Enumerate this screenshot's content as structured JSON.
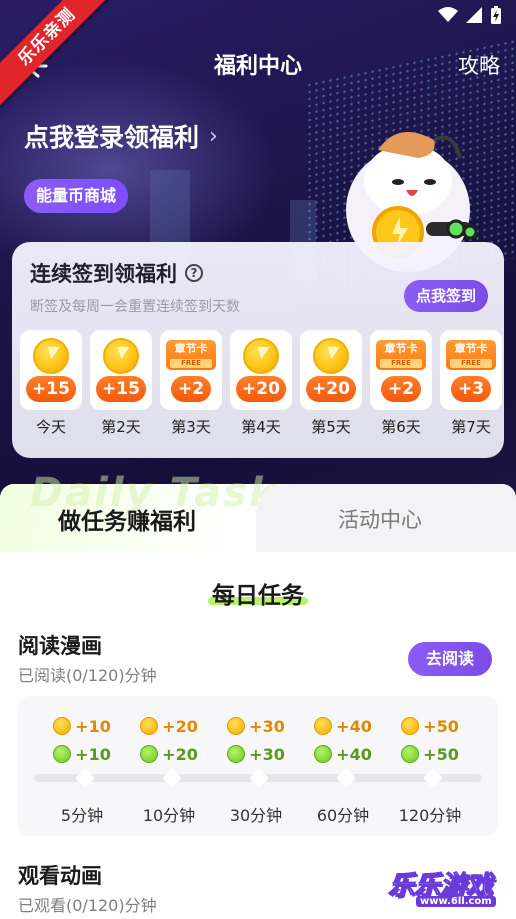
{
  "status_bar": {
    "icons": [
      "wifi-icon",
      "signal-icon",
      "battery-charging-icon"
    ]
  },
  "ribbon": "乐乐亲测",
  "header": {
    "title": "福利中心",
    "guide": "攻略"
  },
  "hero": {
    "login_text": "点我登录领福利",
    "login_chevron": "›",
    "shop_button": "能量币商城"
  },
  "sign_in": {
    "title": "连续签到领福利",
    "help": "?",
    "subtitle": "断签及每周一会重置连续签到天数",
    "button": "点我签到",
    "days": [
      {
        "label": "今天",
        "reward": "+15",
        "type": "coin"
      },
      {
        "label": "第2天",
        "reward": "+15",
        "type": "coin"
      },
      {
        "label": "第3天",
        "reward": "+2",
        "type": "card",
        "card_text": "章节卡",
        "card_free": "FREE"
      },
      {
        "label": "第4天",
        "reward": "+20",
        "type": "coin"
      },
      {
        "label": "第5天",
        "reward": "+20",
        "type": "coin"
      },
      {
        "label": "第6天",
        "reward": "+2",
        "type": "card",
        "card_text": "章节卡",
        "card_free": "FREE"
      },
      {
        "label": "第7天",
        "reward": "+3",
        "type": "card",
        "card_text": "章节卡",
        "card_free": "FREE"
      }
    ]
  },
  "tabs": {
    "watermark": "Daily Task",
    "active": "做任务赚福利",
    "inactive": "活动中心"
  },
  "daily": {
    "title": "每日任务",
    "read": {
      "name": "阅读漫画",
      "progress": "已阅读(0/120)分钟",
      "button": "去阅读"
    },
    "rewards": [
      {
        "gold": "+10",
        "green": "+10",
        "minutes": "5分钟"
      },
      {
        "gold": "+20",
        "green": "+20",
        "minutes": "10分钟"
      },
      {
        "gold": "+30",
        "green": "+30",
        "minutes": "30分钟"
      },
      {
        "gold": "+40",
        "green": "+40",
        "minutes": "60分钟"
      },
      {
        "gold": "+50",
        "green": "+50",
        "minutes": "120分钟"
      }
    ],
    "watch": {
      "name": "观看动画",
      "progress": "已观看(0/120)分钟"
    }
  },
  "watermark_logo": {
    "text": "乐乐游戏",
    "url": "www.6ll.com"
  },
  "colors": {
    "accent": "#8b5cf6",
    "orange": "#f45a0e",
    "green": "#b9f26a",
    "hero_bg": "#1c1447"
  }
}
